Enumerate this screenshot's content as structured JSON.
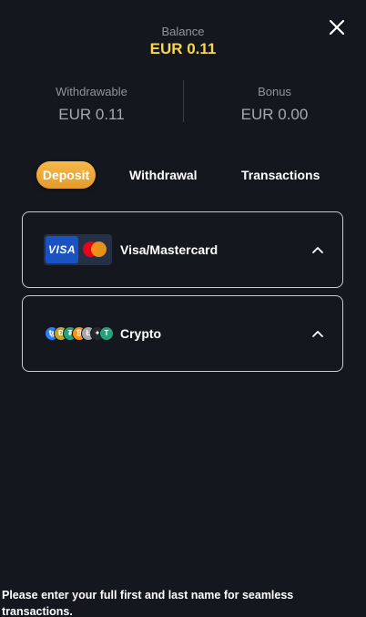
{
  "balance": {
    "label": "Balance",
    "value": "EUR 0.11"
  },
  "stats": {
    "withdrawable": {
      "label": "Withdrawable",
      "value": "EUR 0.11"
    },
    "bonus": {
      "label": "Bonus",
      "value": "EUR 0.00"
    }
  },
  "tabs": [
    {
      "label": "Deposit",
      "active": true
    },
    {
      "label": "Withdrawal",
      "active": false
    },
    {
      "label": "Transactions",
      "active": false
    }
  ],
  "methods": [
    {
      "label": "Visa/Mastercard",
      "icon": "visa-mastercard-logo",
      "card_text": "VISA"
    },
    {
      "label": "Crypto",
      "icon": "crypto-coins-logo",
      "coins": [
        "ꜩ",
        "Ð",
        "₮",
        "₿",
        "Ł",
        "✦",
        "T"
      ]
    }
  ],
  "notice": "Please enter your full first and last name for seamless transactions.",
  "colors": {
    "background": "#15171e",
    "accent_yellow": "#f9d649",
    "tab_active": "#f0ad3d",
    "border": "#c9ccd2",
    "muted_text": "#8f949e"
  }
}
